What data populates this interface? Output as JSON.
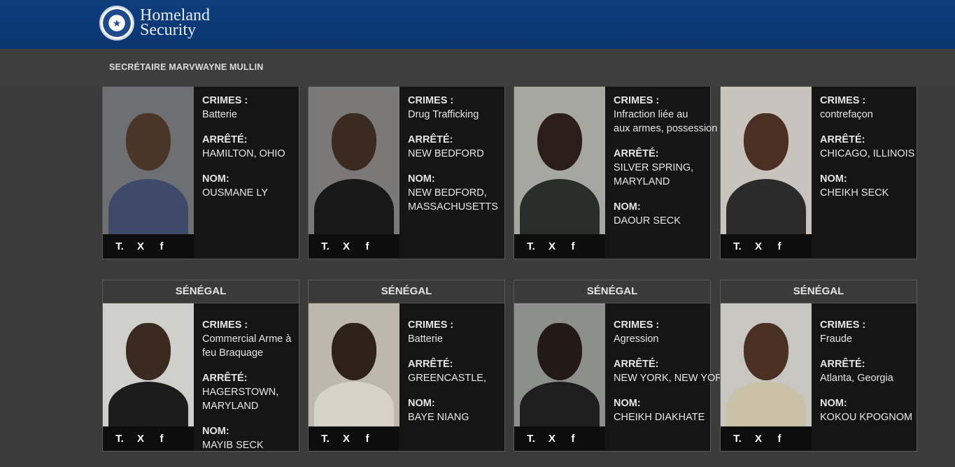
{
  "header": {
    "logo_line1": "Homeland",
    "logo_line2": "Security"
  },
  "subheader": {
    "secretary": "SECRÉTAIRE MARVWAYNE MULLIN"
  },
  "labels": {
    "crimes": "CRIMES :",
    "arrested": "ARRÊTÉ:",
    "name": "NOM:"
  },
  "share_icons": [
    "truth-social-icon",
    "x-icon",
    "facebook-icon"
  ],
  "cards_top": [
    {
      "crimes": [
        "Batterie"
      ],
      "arrested": [
        "HAMILTON, OHIO"
      ],
      "name": [
        "OUSMANE LY"
      ],
      "photo": {
        "bg": "#6e6f73",
        "skin": "#4b3528",
        "shirt": "#3f4a6a"
      }
    },
    {
      "crimes": [
        "Drug Trafficking"
      ],
      "arrested": [
        "NEW BEDFORD"
      ],
      "name": [
        "NEW BEDFORD,",
        "MASSACHUSETTS"
      ],
      "photo": {
        "bg": "#7a7978",
        "skin": "#3a2a20",
        "shirt": "#181818"
      }
    },
    {
      "crimes": [
        "Infraction liée au",
        "aux armes, possession"
      ],
      "arrested": [
        "SILVER SPRING,",
        "MARYLAND"
      ],
      "name": [
        "DAOUR SECK"
      ],
      "photo": {
        "bg": "#a6a7a1",
        "skin": "#2b1e18",
        "shirt": "#2a2e2a"
      }
    },
    {
      "crimes": [
        "contrefaçon"
      ],
      "arrested": [
        "CHICAGO, ILLINOIS"
      ],
      "name": [
        "CHEIKH SECK"
      ],
      "photo": {
        "bg": "#c9c3bd",
        "skin": "#4a2f22",
        "shirt": "#2b2b2b"
      }
    }
  ],
  "cards_bottom": [
    {
      "country": "SÉNÉGAL",
      "crimes": [
        "Commercial Arme à",
        "feu Braquage"
      ],
      "arrested": [
        "HAGERSTOWN,",
        "MARYLAND"
      ],
      "name": [
        "MAYIB SECK"
      ],
      "photo": {
        "bg": "#cfd0cb",
        "skin": "#3a2a20",
        "shirt": "#1c1c1c"
      }
    },
    {
      "country": "SÉNÉGAL",
      "crimes": [
        "Batterie"
      ],
      "arrested": [
        "GREENCASTLE,"
      ],
      "name": [
        "BAYE NIANG"
      ],
      "photo": {
        "bg": "#bdb7ae",
        "skin": "#2e2119",
        "shirt": "#d8d3c8"
      }
    },
    {
      "country": "SÉNÉGAL",
      "crimes": [
        "Agression"
      ],
      "arrested": [
        "NEW YORK, NEW YORK"
      ],
      "name": [
        "CHEIKH DIAKHATE"
      ],
      "photo": {
        "bg": "#8d8f8c",
        "skin": "#231a15",
        "shirt": "#1e1e1e"
      }
    },
    {
      "country": "SÉNÉGAL",
      "crimes": [
        "Fraude"
      ],
      "arrested": [
        "Atlanta, Georgia"
      ],
      "name": [
        "KOKOU KPOGNOM"
      ],
      "photo": {
        "bg": "#c8c6c1",
        "skin": "#4a3022",
        "shirt": "#c9c1a8"
      }
    }
  ]
}
